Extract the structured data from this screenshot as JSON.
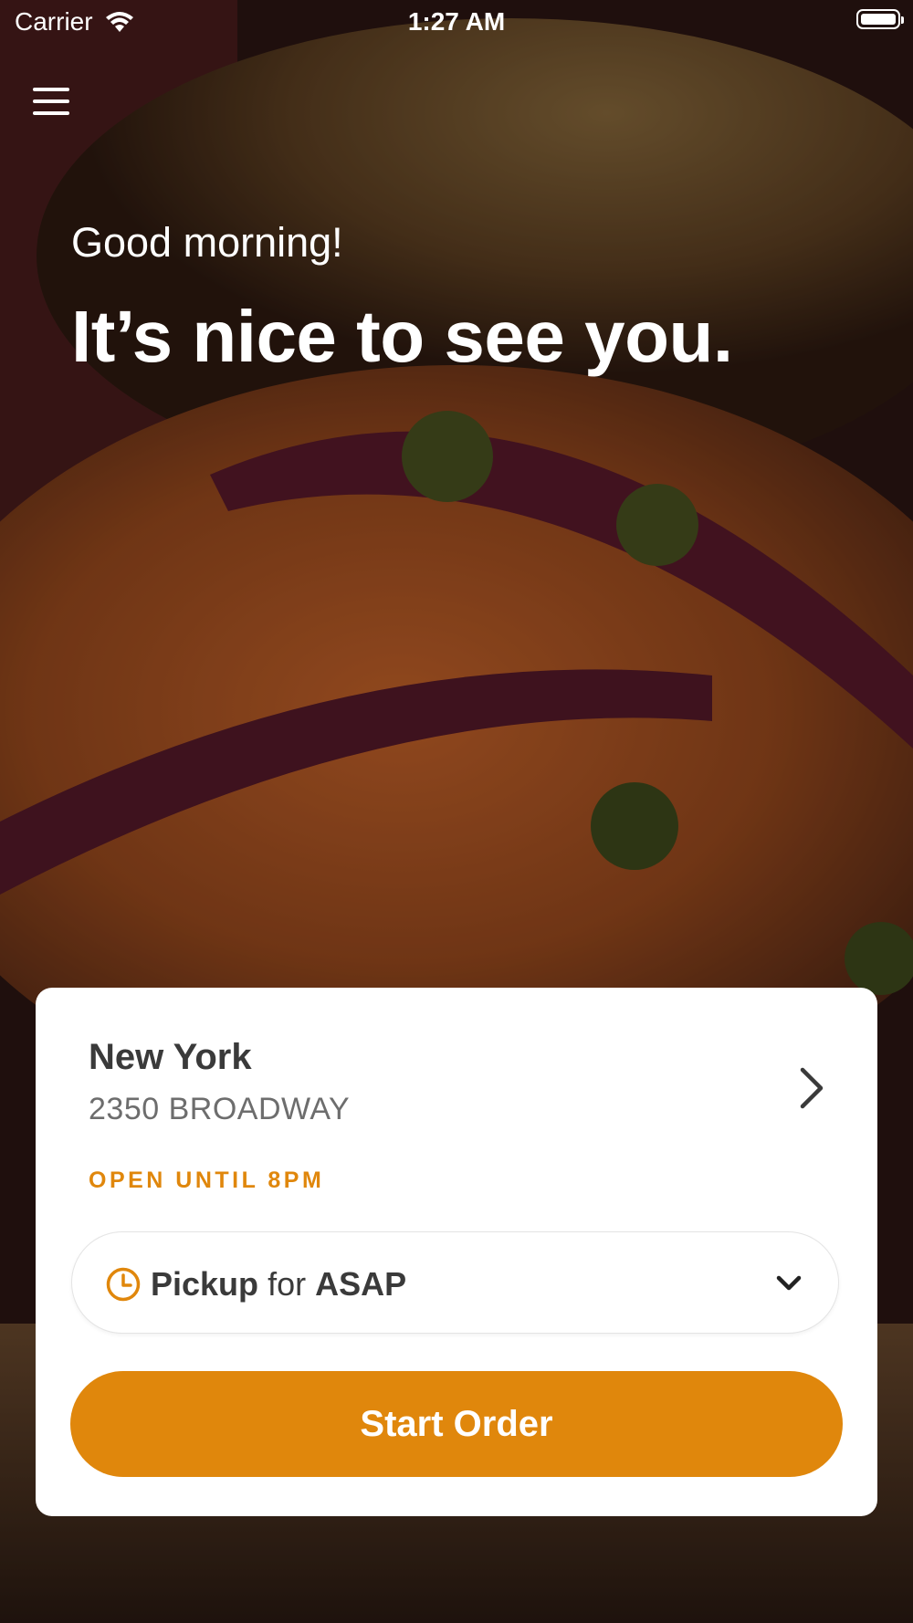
{
  "status_bar": {
    "carrier": "Carrier",
    "time": "1:27 AM",
    "wifi_icon": "wifi-icon",
    "battery_icon": "battery-icon"
  },
  "header": {
    "menu_icon": "hamburger-menu-icon"
  },
  "hero": {
    "greeting": "Good morning!",
    "headline": "It’s nice to see you.",
    "background": "bagel-with-lox-photo"
  },
  "store": {
    "name": "New York",
    "address": "2350 BROADWAY",
    "hours": "OPEN UNTIL 8PM",
    "chevron_icon": "chevron-right-icon"
  },
  "order_mode": {
    "mode": "Pickup",
    "connector": "for",
    "time": "ASAP",
    "clock_icon": "clock-icon",
    "dropdown_icon": "chevron-down-icon"
  },
  "actions": {
    "start_order_label": "Start Order"
  },
  "colors": {
    "accent": "#e0870c",
    "card_background": "#ffffff",
    "text_dark": "#3a3a3a",
    "text_muted": "#6d6d6d"
  }
}
